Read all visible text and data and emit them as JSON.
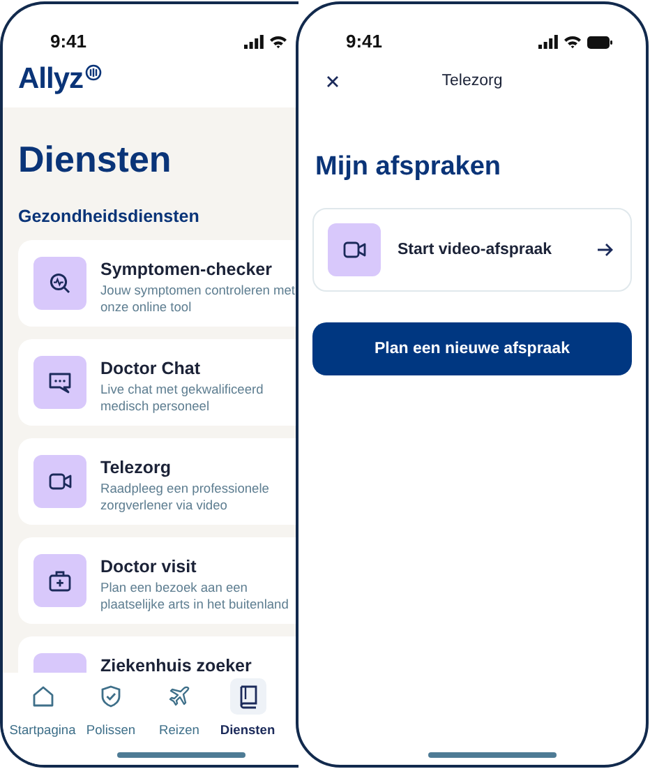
{
  "left_screen": {
    "status_bar": {
      "time": "9:41"
    },
    "logo": "Allyz",
    "title": "Diensten",
    "section_title": "Gezondheidsdiensten",
    "services": [
      {
        "title": "Symptomen-checker",
        "description": "Jouw symptomen controleren met onze online tool"
      },
      {
        "title": "Doctor Chat",
        "description": "Live chat met gekwalificeerd medisch personeel"
      },
      {
        "title": "Telezorg",
        "description": "Raadpleeg een professionele zorgverlener via video"
      },
      {
        "title": "Doctor visit",
        "description": "Plan een bezoek aan een plaatselijke arts in het buitenland"
      },
      {
        "title": "Ziekenhuis zoeker"
      }
    ],
    "tab_bar": [
      {
        "label": "Startpagina",
        "selected": false
      },
      {
        "label": "Polissen",
        "selected": false
      },
      {
        "label": "Reizen",
        "selected": false
      },
      {
        "label": "Diensten",
        "selected": true
      }
    ]
  },
  "right_screen": {
    "status_bar": {
      "time": "9:41"
    },
    "header_title": "Telezorg",
    "title": "Mijn afspraken",
    "appointment_card": {
      "label": "Start video-afspraak"
    },
    "button": "Plan een nieuwe afspraak"
  }
}
